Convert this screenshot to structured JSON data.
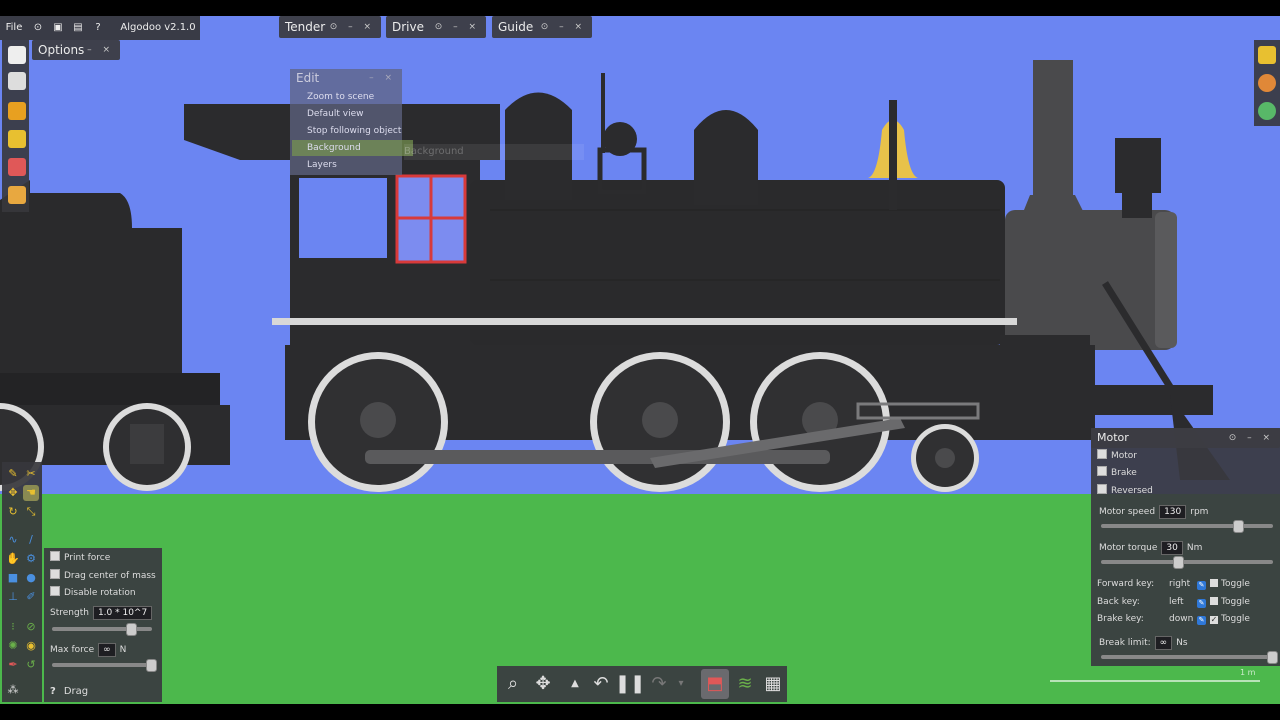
{
  "menubar": {
    "file": "File",
    "version": "Algodoo v2.1.0"
  },
  "titles": {
    "options": "Options",
    "tender": "Tender",
    "drive": "Drive",
    "guide": "Guide",
    "edit": "Edit",
    "motor": "Motor"
  },
  "edit_menu": [
    "Zoom to scene",
    "Default view",
    "Stop following object",
    "Background",
    "Layers"
  ],
  "ghost_background": "Background",
  "drag_panel": {
    "print_force": "Print force",
    "drag_center": "Drag center of mass",
    "disable_rotation": "Disable rotation",
    "strength_label": "Strength",
    "strength_value": "1.0 * 10^7",
    "maxforce_label": "Max force",
    "maxforce_value": "∞",
    "maxforce_unit": "N",
    "tool_name": "Drag",
    "help_icon": "?"
  },
  "motor_panel": {
    "motor": "Motor",
    "brake": "Brake",
    "reversed": "Reversed",
    "speed_label": "Motor speed",
    "speed_value": "130",
    "speed_unit": "rpm",
    "speed_level": 0.81,
    "torque_label": "Motor torque",
    "torque_value": "30",
    "torque_unit": "Nm",
    "torque_level": 0.44,
    "forward_key_label": "Forward key:",
    "forward_key": "right",
    "back_key_label": "Back key:",
    "back_key": "left",
    "brake_key_label": "Brake key:",
    "brake_key": "down",
    "toggle": "Toggle",
    "break_limit_label": "Break limit:",
    "break_limit_value": "∞",
    "break_limit_unit": "Ns"
  },
  "scale_text": "1 m",
  "colors": {
    "sky": "#6b85f2",
    "ground": "#4cb84c",
    "loco": "#2e2e30",
    "bell": "#e8c24a",
    "panel": "#3a3a40"
  }
}
